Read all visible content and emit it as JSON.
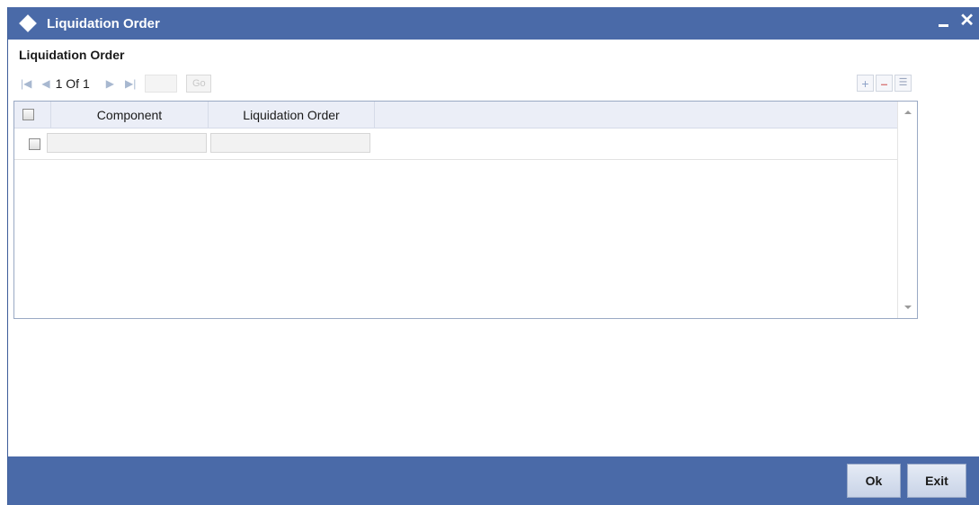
{
  "window": {
    "title": "Liquidation Order"
  },
  "section": {
    "title": "Liquidation Order"
  },
  "pager": {
    "text": "1 Of 1",
    "go_label": "Go",
    "page_value": ""
  },
  "grid": {
    "columns": [
      "Component",
      "Liquidation Order"
    ],
    "rows": [
      {
        "component": "",
        "liquidation_order": ""
      }
    ]
  },
  "footer": {
    "ok_label": "Ok",
    "exit_label": "Exit"
  },
  "icons": {
    "title": "diamond-icon",
    "minimize": "minimize-icon",
    "close": "close-icon",
    "first": "first-page-icon",
    "prev": "prev-page-icon",
    "next": "next-page-icon",
    "last": "last-page-icon",
    "add": "add-row-icon",
    "delete": "delete-row-icon",
    "view": "single-view-icon"
  },
  "colors": {
    "titlebar": "#4a6aa8",
    "footer": "#4a6aa8",
    "grid_header": "#ebeef7"
  }
}
